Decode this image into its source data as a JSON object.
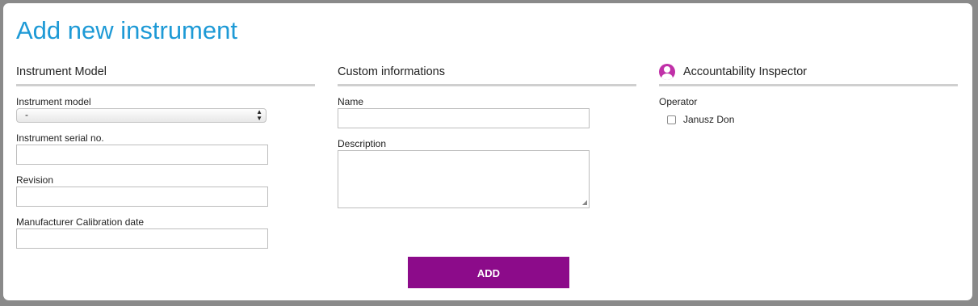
{
  "page": {
    "title": "Add new instrument"
  },
  "sections": {
    "instrument_model": {
      "heading": "Instrument Model"
    },
    "custom_informations": {
      "heading": "Custom informations"
    },
    "accountability": {
      "heading": "Accountability Inspector",
      "icon": "user-avatar-icon"
    }
  },
  "fields": {
    "instrument_model": {
      "label": "Instrument model",
      "value": "-"
    },
    "serial_no": {
      "label": "Instrument serial no.",
      "value": ""
    },
    "revision": {
      "label": "Revision",
      "value": ""
    },
    "calibration_date": {
      "label": "Manufacturer Calibration date",
      "value": ""
    },
    "name": {
      "label": "Name",
      "value": ""
    },
    "description": {
      "label": "Description",
      "value": ""
    }
  },
  "operator": {
    "label": "Operator",
    "options": [
      {
        "label": "Janusz Don",
        "checked": false
      }
    ]
  },
  "actions": {
    "add_label": "ADD"
  },
  "colors": {
    "title": "#1e9ad6",
    "accent": "#8c0b8a",
    "avatar": "#c030a8"
  }
}
